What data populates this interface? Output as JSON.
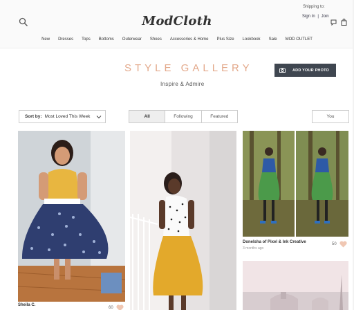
{
  "header": {
    "logo": "ModCloth",
    "shipping_label": "Shipping to:",
    "sign_in": "Sign In",
    "separator": "|",
    "join": "Join"
  },
  "nav": {
    "items": [
      "New",
      "Dresses",
      "Tops",
      "Bottoms",
      "Outerwear",
      "Shoes",
      "Accessories & Home",
      "Plus Size",
      "Lookbook",
      "Sale",
      "MOD OUTLET"
    ]
  },
  "hero": {
    "title": "STYLE GALLERY",
    "subtitle": "Inspire & Admire",
    "add_photo": "ADD YOUR PHOTO"
  },
  "filters": {
    "sort_label": "Sort by:",
    "sort_value": "Most Loved This Week",
    "tabs": [
      "All",
      "Following",
      "Featured"
    ],
    "active_tab": "All",
    "you": "You"
  },
  "gallery": {
    "cards": [
      {
        "name": "Sheila C.",
        "likes": "60"
      },
      {
        "name": "",
        "likes": ""
      },
      {
        "name": "Donelsha of Pixel & Ink Creative",
        "time": "3 months ago",
        "likes": "50"
      }
    ]
  },
  "colors": {
    "title_accent": "#e3a98b",
    "button_bg": "#3f4650",
    "heart": "#f0c7b3"
  }
}
